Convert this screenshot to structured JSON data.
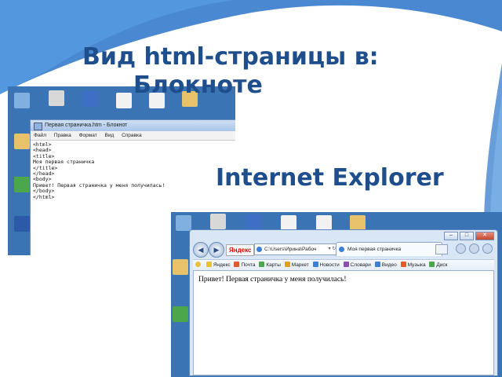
{
  "slide": {
    "title_line1": "Вид html-страницы в:",
    "title_line2": "Блокноте",
    "title_ie": "Internet Explorer"
  },
  "notepad": {
    "window_title": "Первая страничка.htm - Блокнот",
    "menu": [
      "Файл",
      "Правка",
      "Формат",
      "Вид",
      "Справка"
    ],
    "lines": [
      "<html>",
      "<head>",
      "<title>",
      "Моя первая страничка",
      "</title>",
      "</head>",
      "<body>",
      "Привет! Первая страничка у меня получилась!",
      "</body>",
      "</html>"
    ]
  },
  "ie": {
    "caption_buttons": [
      "–",
      "□",
      "✕"
    ],
    "search_brand": "Яндекс",
    "address": "C:\\Users\\Ирина\\Рабоч",
    "tab_title": "Моя первая страничка",
    "links": [
      "Яндекс",
      "Почта",
      "Карты",
      "Маркет",
      "Новости",
      "Словари",
      "Видео",
      "Музыка",
      "Диск"
    ],
    "link_colors": [
      "#e8c23a",
      "#e05a2a",
      "#4ca64c",
      "#e0a020",
      "#3d7fd6",
      "#8a4fb0",
      "#3d7fd6",
      "#e05a2a",
      "#4ca64c"
    ],
    "page_text": "Привет! Первая страничка у меня получилась!"
  }
}
